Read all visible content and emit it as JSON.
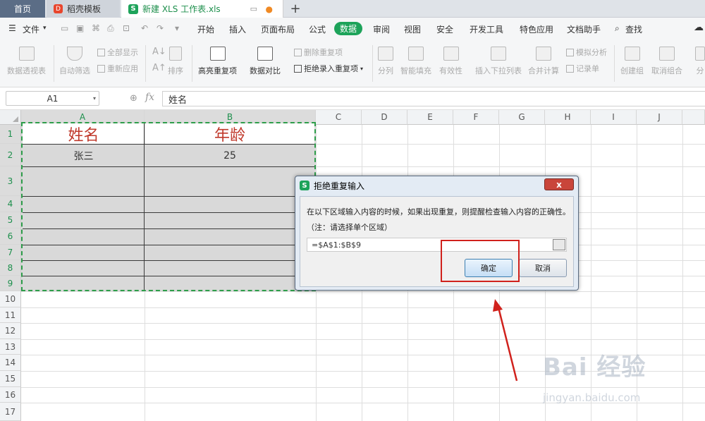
{
  "tabs": {
    "home": "首页",
    "template": "稻壳模板",
    "file": "新建 XLS 工作表.xls",
    "add": "+",
    "template_icon_text": "D",
    "file_icon_text": "S"
  },
  "menu": {
    "file": "文件",
    "items": [
      "开始",
      "插入",
      "页面布局",
      "公式",
      "数据",
      "审阅",
      "视图",
      "安全",
      "开发工具",
      "特色应用",
      "文档助手"
    ],
    "search": "查找"
  },
  "toolbar": {
    "pivot": "数据透视表",
    "autofilter": "自动筛选",
    "show_all": "全部显示",
    "reapply": "重新应用",
    "sort": "排序",
    "highlight_dup": "高亮重复项",
    "compare": "数据对比",
    "remove_dup": "删除重复项",
    "reject_dup": "拒绝录入重复项",
    "split": "分列",
    "smart_fill": "智能填充",
    "validity": "有效性",
    "insert_dropdown": "插入下拉列表",
    "consolidate": "合并计算",
    "simulate": "模拟分析",
    "record": "记录单",
    "create_group": "创建组",
    "ungroup": "取消组合",
    "subtotal": "分"
  },
  "formula_bar": {
    "name_box": "A1",
    "fx": "fx",
    "content": "姓名"
  },
  "columns": [
    "A",
    "B",
    "C",
    "D",
    "E",
    "F",
    "G",
    "H",
    "I",
    "J"
  ],
  "rows": [
    "1",
    "2",
    "3",
    "4",
    "5",
    "6",
    "7",
    "8",
    "9",
    "10",
    "11",
    "12",
    "13",
    "14",
    "15",
    "16",
    "17"
  ],
  "cells": {
    "A1": "姓名",
    "B1": "年龄",
    "A2": "张三",
    "B2": "25"
  },
  "dialog": {
    "icon_text": "S",
    "title": "拒绝重复输入",
    "close": "x",
    "message": "在以下区域输入内容的时候，如果出现重复，则提醒检查输入内容的正确性。",
    "note": "（注：请选择单个区域）",
    "range_value": "=$A$1:$B$9",
    "ok": "确定",
    "cancel": "取消"
  },
  "watermark": {
    "brand": "Bai 经验",
    "url": "jingyan.baidu.com"
  },
  "colors": {
    "accent_green": "#1da35a",
    "header_red": "#c0392b",
    "highlight_red": "#d0211c",
    "selection_gray": "#d9d9d9"
  }
}
